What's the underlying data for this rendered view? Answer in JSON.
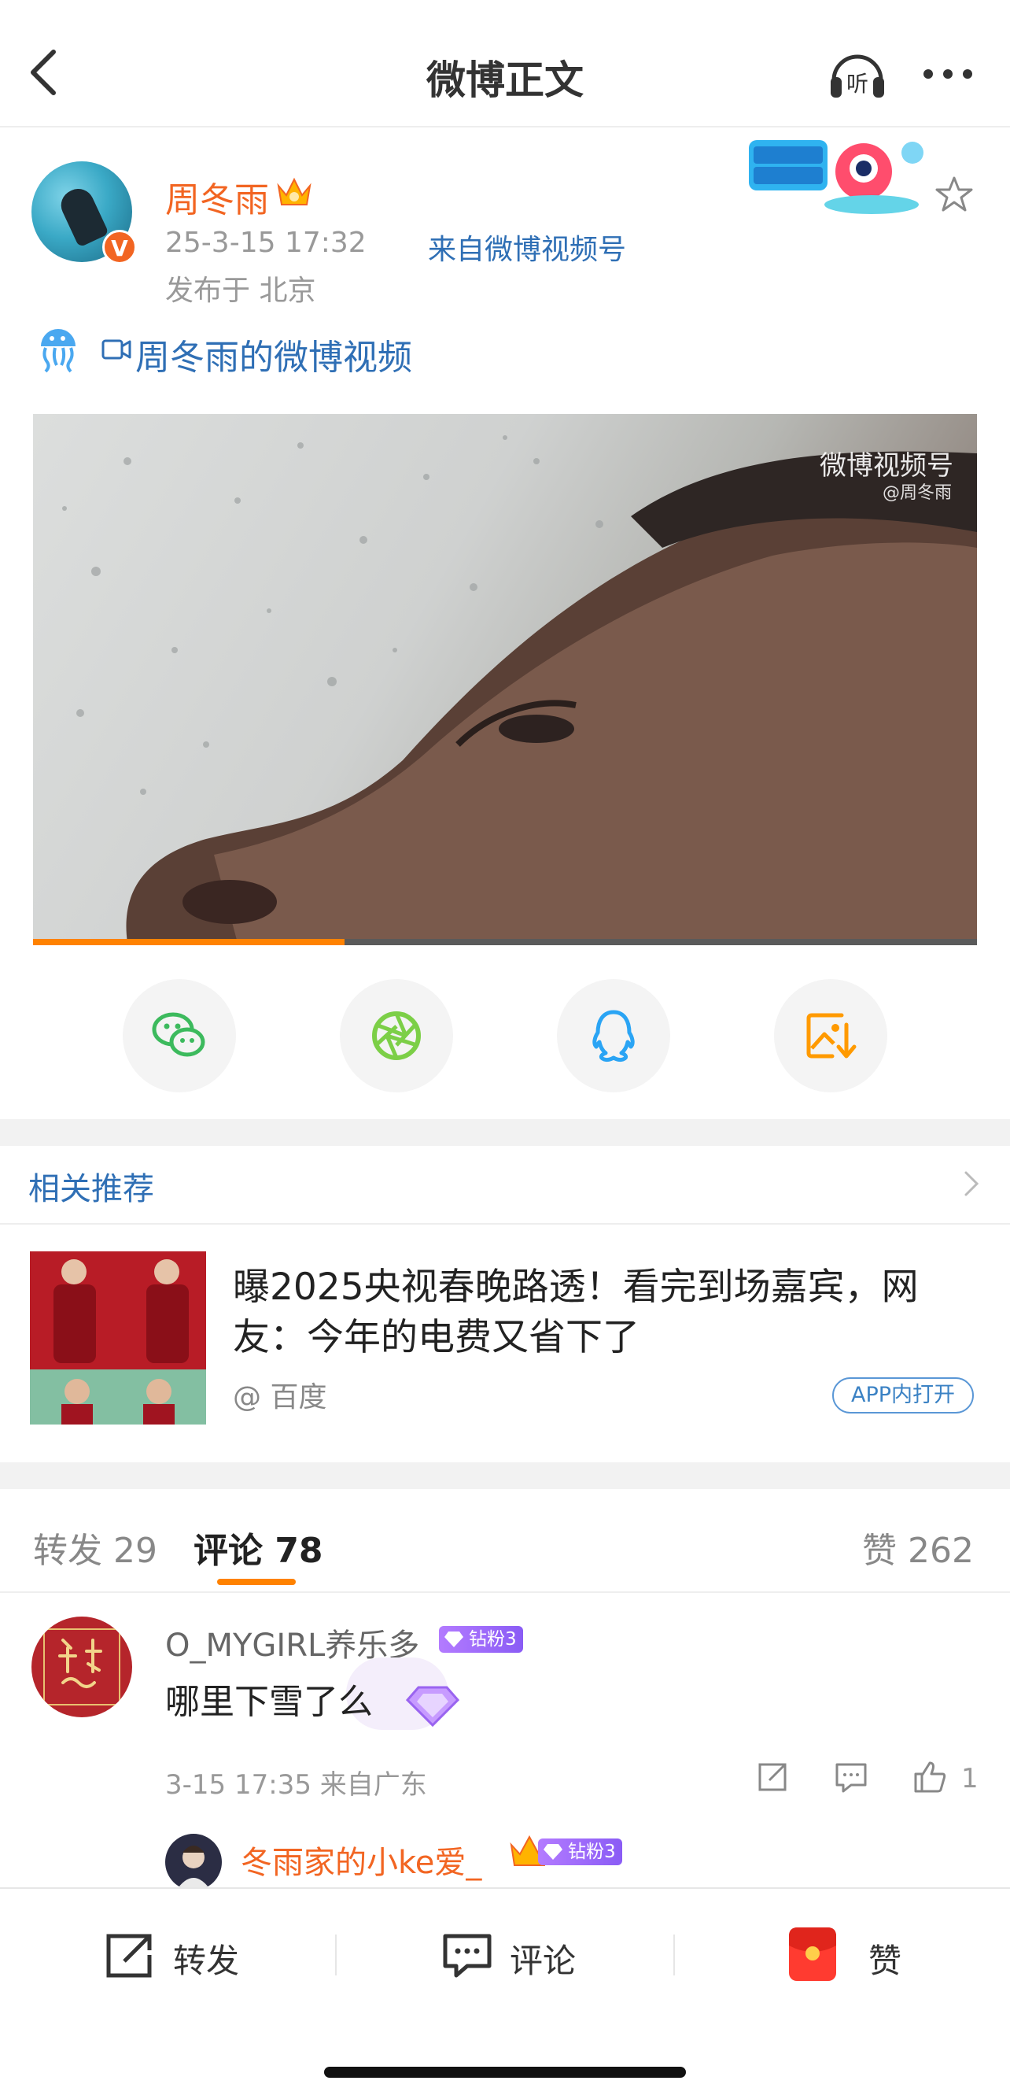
{
  "header": {
    "title": "微博正文"
  },
  "author": {
    "name": "周冬雨",
    "verify_mark": "V",
    "time": "25-3-15 17:32",
    "source": "来自微博视频号",
    "location": "发布于 北京"
  },
  "post": {
    "video_link": "周冬雨的微博视频",
    "watermark": "微博视频号",
    "watermark_user": "@周冬雨",
    "video_progress": 0.33
  },
  "share": {
    "items": [
      {
        "icon": "wechat-icon",
        "color": "#3cba5d"
      },
      {
        "icon": "moments-icon",
        "color": "#7ccf47"
      },
      {
        "icon": "qq-icon",
        "color": "#2aa4f4"
      },
      {
        "icon": "save-image-icon",
        "color": "#ff9a00"
      }
    ]
  },
  "related": {
    "title": "相关推荐",
    "news_title": "曝2025央视春晚路透！看完到场嘉宾，网友：今年的电费又省下了",
    "news_source": "@ 百度",
    "open_app": "APP内打开"
  },
  "tabs": {
    "repost": "转发 29",
    "comment": "评论 78",
    "like": "赞 262"
  },
  "comment": {
    "user": "O_MYGIRL养乐多",
    "badge": "钻粉3",
    "text": "哪里下雪了么",
    "meta": "3-15 17:35  来自广东",
    "like_count": "1",
    "reply_user": "冬雨家的小ke爱_",
    "reply_badge": "钻粉3"
  },
  "bottom_bar": {
    "repost": "转发",
    "comment": "评论",
    "like": "赞"
  },
  "colors": {
    "accent": "#ff8200",
    "link": "#2f6fb5",
    "name": "#f26522"
  }
}
